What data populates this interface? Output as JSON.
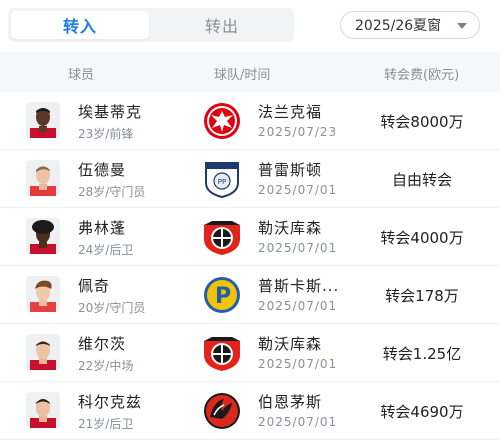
{
  "tabs": {
    "in_label": "转入",
    "out_label": "转出"
  },
  "season_select": {
    "value": "2025/26夏窗"
  },
  "table_header": {
    "player": "球员",
    "team_time": "球队/时间",
    "fee": "转会费(欧元)"
  },
  "rows": [
    {
      "name": "埃基蒂克",
      "info": "23岁/前锋",
      "team": "法兰克福",
      "date": "2025/07/23",
      "fee": "转会8000万",
      "team_logo": "eintracht-frankfurt-eagle"
    },
    {
      "name": "伍德曼",
      "info": "28岁/守门员",
      "team": "普雷斯顿",
      "date": "2025/07/01",
      "fee": "自由转会",
      "team_logo": "preston-lamb"
    },
    {
      "name": "弗林蓬",
      "info": "24岁/后卫",
      "team": "勒沃库森",
      "date": "2025/07/01",
      "fee": "转会4000万",
      "team_logo": "leverkusen-bayer-cross"
    },
    {
      "name": "佩奇",
      "info": "20岁/守门员",
      "team": "普斯卡斯...",
      "date": "2025/07/01",
      "fee": "转会178万",
      "team_logo": "puskas-p"
    },
    {
      "name": "维尔茨",
      "info": "22岁/中场",
      "team": "勒沃库森",
      "date": "2025/07/01",
      "fee": "转会1.25亿",
      "team_logo": "leverkusen-bayer-cross"
    },
    {
      "name": "科尔克兹",
      "info": "21岁/后卫",
      "team": "伯恩茅斯",
      "date": "2025/07/01",
      "fee": "转会4690万",
      "team_logo": "bournemouth-cherry"
    }
  ],
  "colors": {
    "accent": "#1e7cf2",
    "muted": "#8a8f99",
    "header_bg": "#f6f7f9"
  }
}
